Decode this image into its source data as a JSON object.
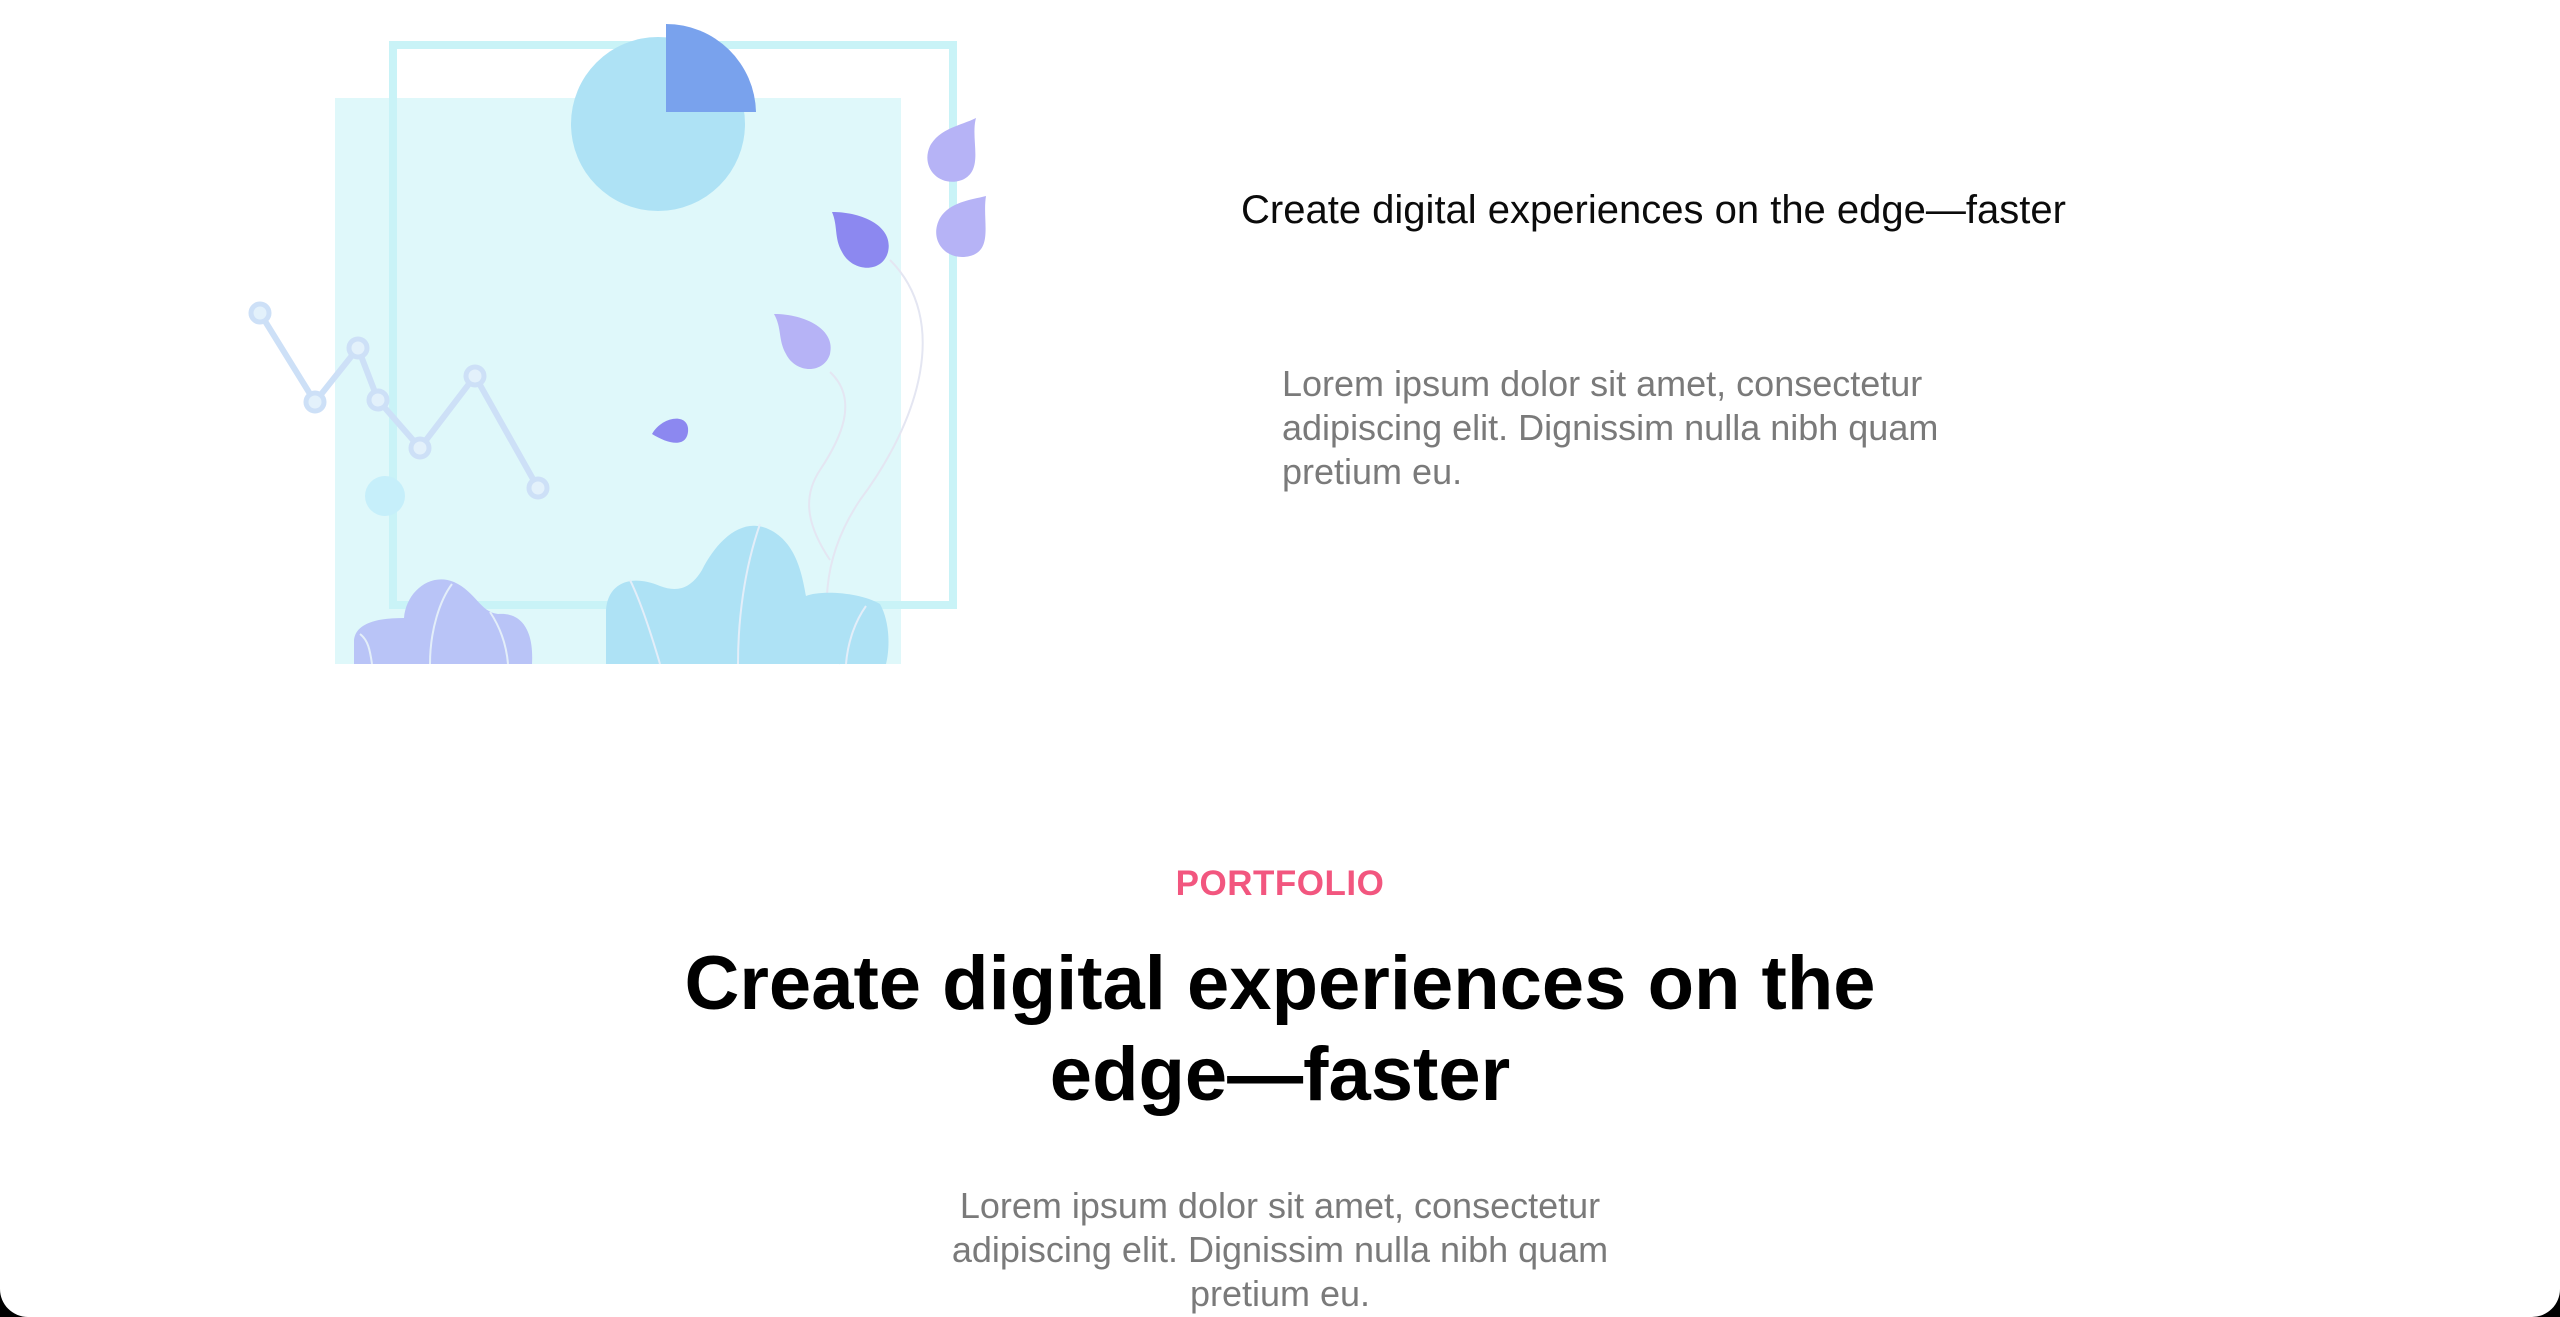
{
  "feature": {
    "title": "Create digital experiences on the edge—faster",
    "description": "Lorem ipsum dolor sit amet, consectetur adipiscing elit. Dignissim nulla nibh quam pretium eu."
  },
  "portfolio": {
    "eyebrow": "PORTFOLIO",
    "heading": "Create digital experiences on the edge—faster",
    "description": "Lorem ipsum dolor sit amet, consectetur adipiscing elit. Dignissim nulla nibh quam pretium eu."
  },
  "colors": {
    "accent_pink": "#f2567f",
    "heading": "#000000",
    "body_text": "#7a7a7a",
    "panel_cyan": "#dff8fa",
    "circle_blue": "#aee2f5",
    "pie_blue": "#79a2ed",
    "drop_violet": "#b6b3f6",
    "drop_indigo": "#8c88f0"
  },
  "icons": {
    "illustration": "analytics-illustration"
  }
}
